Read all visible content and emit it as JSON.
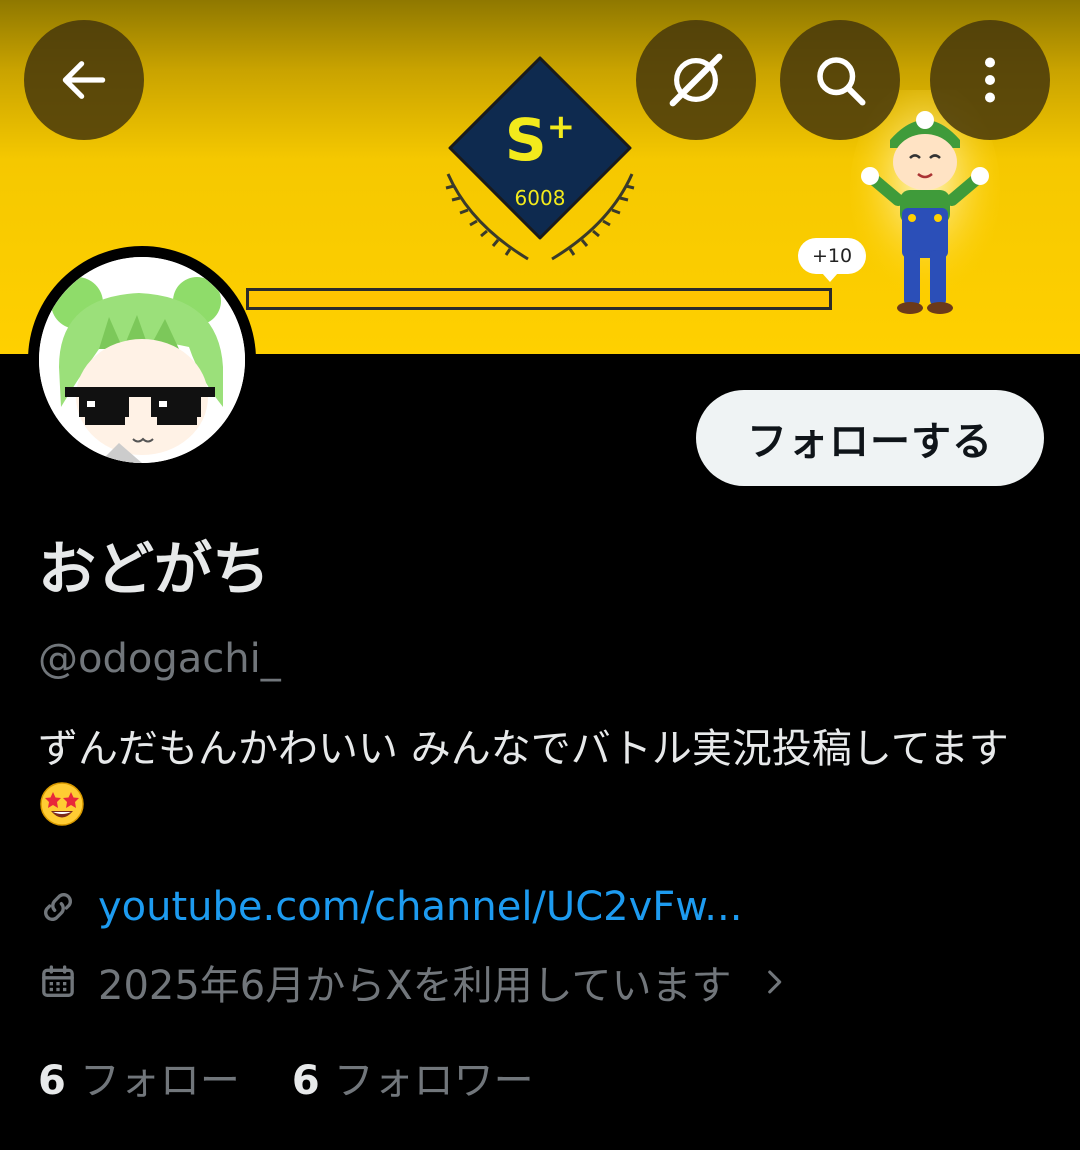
{
  "banner": {
    "rank": "S",
    "rank_plus": "+",
    "score": "6008",
    "gain": "+10",
    "progress_fraction": 0.0
  },
  "icons": {
    "back": "arrow-left-icon",
    "grok": "grok-icon",
    "search": "search-icon",
    "more": "more-vertical-icon",
    "link": "link-icon",
    "calendar": "calendar-icon",
    "chevron": "chevron-right-icon"
  },
  "profile": {
    "follow_label": "フォローする",
    "display_name": "おどがち",
    "handle": "@odogachi_",
    "bio": "ずんだもんかわいい みんなでバトル実況投稿してます",
    "bio_emoji": "star-struck-emoji",
    "link": "youtube.com/channel/UC2vFw...",
    "joined": "2025年6月からXを利用しています"
  },
  "stats": {
    "following_count": "6",
    "following_label": "フォロー",
    "followers_count": "6",
    "followers_label": "フォロワー"
  },
  "colors": {
    "background": "#000000",
    "banner_yellow": "#ffd000",
    "link_blue": "#1d9bf0",
    "secondary_text": "#71767b",
    "primary_text": "#e7e9ea"
  }
}
